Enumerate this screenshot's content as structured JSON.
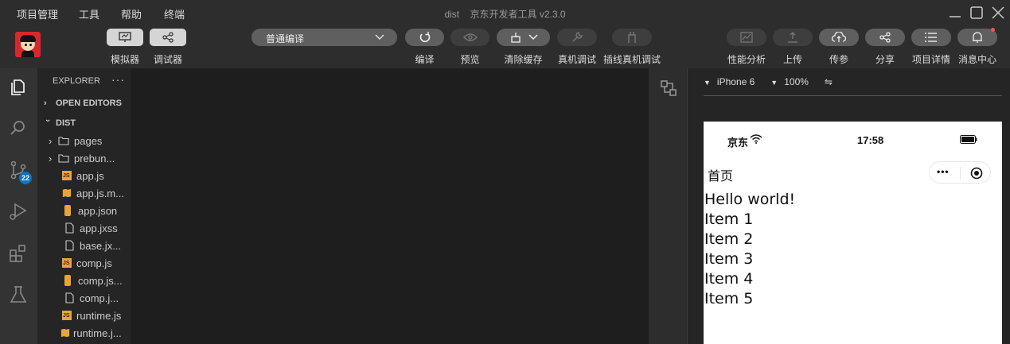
{
  "menu": [
    "项目管理",
    "工具",
    "帮助",
    "终端"
  ],
  "window_title": "dist    京东开发者工具 v2.3.0",
  "toolbar": {
    "simulator_label": "模拟器",
    "debugger_label": "调试器",
    "compile_mode": "普通编译",
    "compile_label": "编译",
    "preview_label": "预览",
    "clear_cache_label": "清除缓存",
    "real_debug_label": "真机调试",
    "plugin_debug_label": "插线真机调试",
    "perf_label": "性能分析",
    "upload_label": "上传",
    "pass_param_label": "传参",
    "share_label": "分享",
    "project_detail_label": "项目详情",
    "message_center_label": "消息中心",
    "accent_dot": "#ff4d4f"
  },
  "activity": {
    "scm_badge": "22"
  },
  "explorer": {
    "title": "EXPLORER",
    "more": "···",
    "open_editors": "OPEN EDITORS",
    "root": "DIST",
    "items": [
      {
        "name": "pages",
        "icon": "folder-icon"
      },
      {
        "name": "prebun...",
        "icon": "folder-icon"
      },
      {
        "name": "app.js",
        "icon": "js-file-icon"
      },
      {
        "name": "app.js.m...",
        "icon": "map-file-icon"
      },
      {
        "name": "app.json",
        "icon": "json-file-icon"
      },
      {
        "name": "app.jxss",
        "icon": "file-icon"
      },
      {
        "name": "base.jx...",
        "icon": "file-icon"
      },
      {
        "name": "comp.js",
        "icon": "js-file-icon"
      },
      {
        "name": "comp.js...",
        "icon": "json-file-icon"
      },
      {
        "name": "comp.j...",
        "icon": "file-icon"
      },
      {
        "name": "runtime.js",
        "icon": "js-file-icon"
      },
      {
        "name": "runtime.j...",
        "icon": "map-file-icon"
      }
    ]
  },
  "simulator": {
    "device": "iPhone 6",
    "zoom": "100%",
    "rotate": "⇋",
    "carrier": "京东",
    "time": "17:58",
    "nav_title": "首页",
    "capsule_more": "•••",
    "content": [
      "Hello world!",
      "Item 1",
      "Item 2",
      "Item 3",
      "Item 4",
      "Item 5"
    ]
  },
  "colors": {
    "accent": "#0e70c0",
    "folder": "#cccccc",
    "js": "#e8a33d"
  }
}
